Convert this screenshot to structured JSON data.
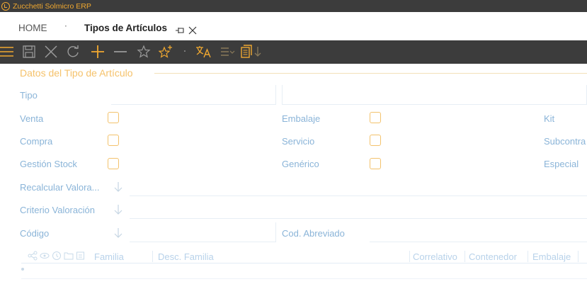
{
  "window": {
    "title": "Zucchetti Solmicro ERP"
  },
  "breadcrumb": {
    "home": "HOME",
    "separator": "·",
    "current": "Tipos de Artículos"
  },
  "toolbar": {
    "items": [
      "menu-icon",
      "save-icon",
      "cancel-icon",
      "refresh-icon",
      "add-icon",
      "remove-icon",
      "favorite-icon",
      "new-favorite-icon",
      "separator-dot",
      "translate-icon",
      "list-options-icon",
      "documents-icon"
    ],
    "separator": "·",
    "accent": "#f0a830",
    "background": "#3c3c3c"
  },
  "section": {
    "title": "Datos del Tipo de Artículo"
  },
  "form": {
    "tipo_label": "Tipo",
    "venta_label": "Venta",
    "compra_label": "Compra",
    "gestion_stock_label": "Gestión Stock",
    "embalaje_label": "Embalaje",
    "servicio_label": "Servicio",
    "generico_label": "Genérico",
    "kit_label": "Kit",
    "subcontratacion_label": "Subcontra",
    "especial_label": "Especial",
    "recalcular_label": "Recalcular Valora...",
    "criterio_label": "Criterio Valoración",
    "codigo_label": "Código",
    "cod_abreviado_label": "Cod. Abreviado"
  },
  "grid": {
    "columns": [
      "Familia",
      "Desc. Familia",
      "Correlativo",
      "Contenedor",
      "Embalaje"
    ]
  },
  "colors": {
    "label": "#8ab4d8",
    "section_title": "#f5c26b",
    "checkbox_border": "#f3c26c",
    "grid_header": "#b8d2ea"
  }
}
